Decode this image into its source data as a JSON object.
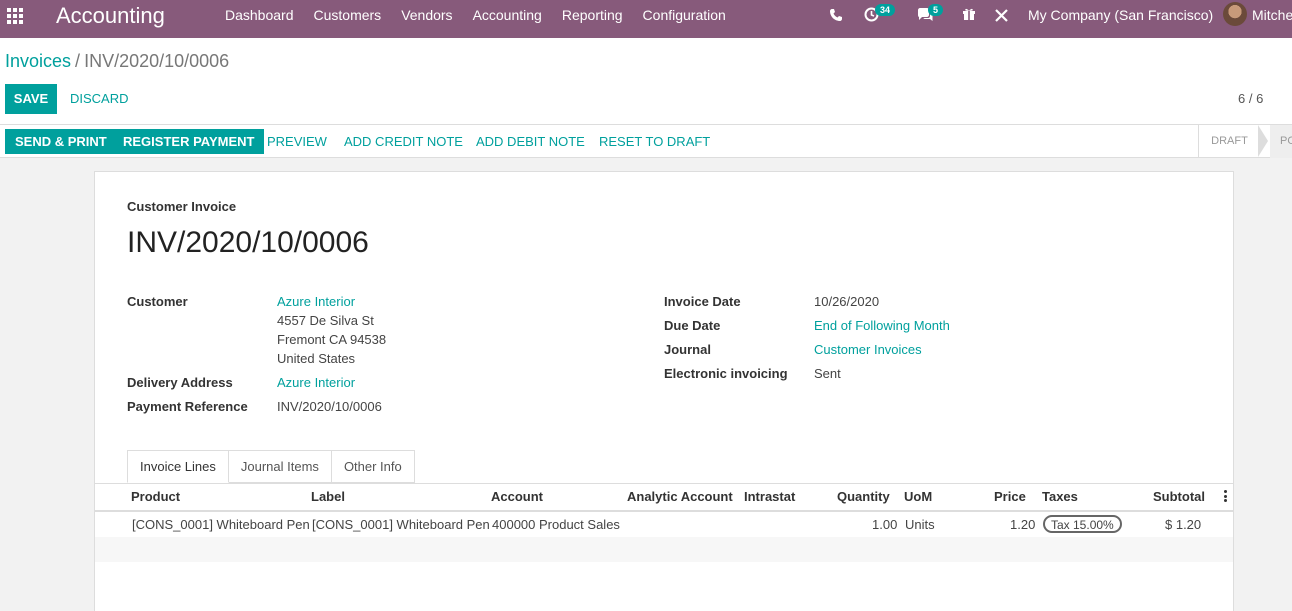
{
  "nav": {
    "brand": "Accounting",
    "menu": [
      "Dashboard",
      "Customers",
      "Vendors",
      "Accounting",
      "Reporting",
      "Configuration"
    ],
    "activities_count": "34",
    "messages_count": "5",
    "company": "My Company (San Francisco)",
    "user": "Mitche",
    "icons": [
      "apps-grid-icon",
      "phone-icon",
      "clock-icon",
      "chat-icon",
      "gift-icon",
      "tools-icon"
    ]
  },
  "breadcrumb": {
    "parent": "Invoices",
    "separator": "/",
    "current": "INV/2020/10/0006"
  },
  "toolbar": {
    "save_label": "SAVE",
    "discard_label": "DISCARD",
    "pager": "6 / 6"
  },
  "actions": {
    "send_print": "SEND & PRINT",
    "register_payment": "REGISTER PAYMENT",
    "preview": "PREVIEW",
    "add_credit_note": "ADD CREDIT NOTE",
    "add_debit_note": "ADD DEBIT NOTE",
    "reset_to_draft": "RESET TO DRAFT"
  },
  "stages": {
    "draft": "DRAFT",
    "posted": "PO"
  },
  "invoice": {
    "type": "Customer Invoice",
    "name": "INV/2020/10/0006",
    "customer_label": "Customer",
    "customer_name": "Azure Interior",
    "address": [
      "4557 De Silva St",
      "Fremont CA 94538",
      "United States"
    ],
    "delivery_label": "Delivery Address",
    "delivery_value": "Azure Interior",
    "payment_ref_label": "Payment Reference",
    "payment_ref_value": "INV/2020/10/0006",
    "invoice_date_label": "Invoice Date",
    "invoice_date_value": "10/26/2020",
    "due_date_label": "Due Date",
    "due_date_value": "End of Following Month",
    "journal_label": "Journal",
    "journal_value": "Customer Invoices",
    "einvoicing_label": "Electronic invoicing",
    "einvoicing_value": "Sent"
  },
  "tabs": [
    "Invoice Lines",
    "Journal Items",
    "Other Info"
  ],
  "lines": {
    "headers": [
      "Product",
      "Label",
      "Account",
      "Analytic Account",
      "Intrastat",
      "Quantity",
      "UoM",
      "Price",
      "Taxes",
      "Subtotal"
    ],
    "rows": [
      {
        "product": "[CONS_0001] Whiteboard Pen",
        "label": "[CONS_0001] Whiteboard Pen",
        "account": "400000 Product Sales",
        "analytic": "",
        "intrastat": "",
        "quantity": "1.00",
        "uom": "Units",
        "price": "1.20",
        "tax": "Tax 15.00%",
        "subtotal": "$ 1.20"
      }
    ]
  },
  "colors": {
    "nav_bg": "#875a7b",
    "accent": "#00a09d"
  }
}
